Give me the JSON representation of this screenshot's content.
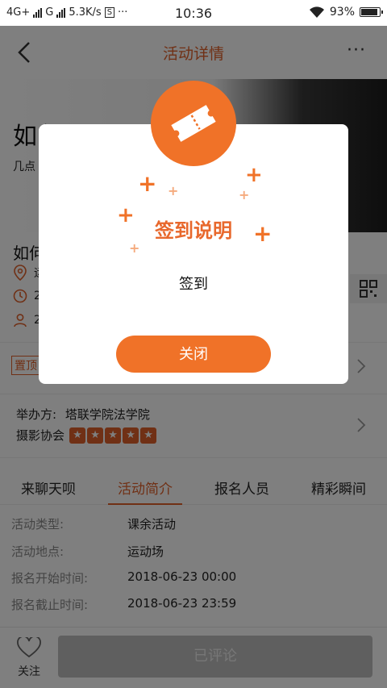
{
  "status_bar": {
    "network": "4G+",
    "carrier2": "G",
    "speed": "5.3K/s",
    "sim_badge": "S",
    "more": "···",
    "time": "10:36",
    "battery": "93%"
  },
  "header": {
    "title": "活动详情",
    "more": "···"
  },
  "banner": {
    "title": "如何",
    "subtitle": "几点"
  },
  "info": {
    "title": "如何",
    "location_partial": "运",
    "time_partial": "2",
    "people_partial": "2"
  },
  "pin_row": {
    "pin_label": "置顶"
  },
  "organizer": {
    "label": "举办方:",
    "name": "塔联学院法学院",
    "club": "摄影协会",
    "rating": 5
  },
  "tabs": [
    {
      "label": "来聊天呗"
    },
    {
      "label": "活动简介",
      "active": true
    },
    {
      "label": "报名人员"
    },
    {
      "label": "精彩瞬间"
    }
  ],
  "details": [
    {
      "key": "活动类型:",
      "value": "课余活动"
    },
    {
      "key": "活动地点:",
      "value": "运动场"
    },
    {
      "key": "报名开始时间:",
      "value": "2018-06-23 00:00"
    },
    {
      "key": "报名截止时间:",
      "value": "2018-06-23 23:59"
    }
  ],
  "bottom_bar": {
    "follow_label": "关注",
    "commented_label": "已评论"
  },
  "modal": {
    "title": "签到说明",
    "body": "签到",
    "close_label": "关闭"
  },
  "colors": {
    "accent": "#f07228",
    "accent_text": "#e0602a",
    "overlay": "rgba(0,0,0,0.5)"
  }
}
